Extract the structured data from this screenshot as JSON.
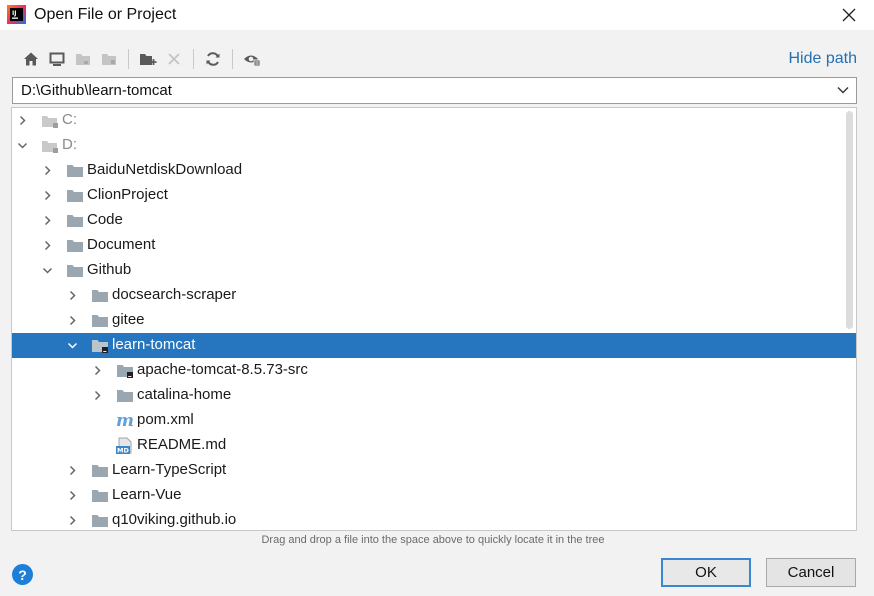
{
  "window": {
    "title": "Open File or Project",
    "close_symbol": "✕"
  },
  "toolbar": {
    "buttons": [
      {
        "name": "home-icon",
        "enabled": true
      },
      {
        "name": "desktop-icon",
        "enabled": true
      },
      {
        "name": "project-folder-icon",
        "enabled": false
      },
      {
        "name": "module-folder-icon",
        "enabled": false
      },
      {
        "name": "new-folder-icon",
        "enabled": true
      },
      {
        "name": "delete-icon",
        "enabled": false
      },
      {
        "name": "refresh-icon",
        "enabled": true
      },
      {
        "name": "show-hidden-icon",
        "enabled": true
      }
    ],
    "hide_path_label": "Hide path"
  },
  "path": {
    "value": "D:\\Github\\learn-tomcat"
  },
  "tree": {
    "rows": [
      {
        "label": "C:",
        "kind": "drive",
        "arrow": "collapsed"
      },
      {
        "label": "D:",
        "kind": "drive",
        "arrow": "expanded"
      },
      {
        "label": "BaiduNetdiskDownload",
        "kind": "folder",
        "arrow": "collapsed"
      },
      {
        "label": "ClionProject",
        "kind": "folder",
        "arrow": "collapsed"
      },
      {
        "label": "Code",
        "kind": "folder",
        "arrow": "collapsed"
      },
      {
        "label": "Document",
        "kind": "folder",
        "arrow": "collapsed"
      },
      {
        "label": "Github",
        "kind": "folder",
        "arrow": "expanded"
      },
      {
        "label": "docsearch-scraper",
        "kind": "folder",
        "arrow": "collapsed"
      },
      {
        "label": "gitee",
        "kind": "folder",
        "arrow": "collapsed"
      },
      {
        "label": "learn-tomcat",
        "kind": "project-folder",
        "arrow": "expanded",
        "selected": true
      },
      {
        "label": "apache-tomcat-8.5.73-src",
        "kind": "project-folder",
        "arrow": "collapsed"
      },
      {
        "label": "catalina-home",
        "kind": "folder",
        "arrow": "collapsed"
      },
      {
        "label": "pom.xml",
        "kind": "maven-file",
        "arrow": "none"
      },
      {
        "label": "README.md",
        "kind": "markdown-file",
        "arrow": "none"
      },
      {
        "label": "Learn-TypeScript",
        "kind": "folder",
        "arrow": "collapsed"
      },
      {
        "label": "Learn-Vue",
        "kind": "folder",
        "arrow": "collapsed"
      },
      {
        "label": "q10viking.github.io",
        "kind": "folder",
        "arrow": "collapsed"
      }
    ]
  },
  "hint": "Drag and drop a file into the space above to quickly locate it in the tree",
  "footer": {
    "help_label": "?",
    "ok_label": "OK",
    "cancel_label": "Cancel"
  },
  "colors": {
    "selection": "#2675bf",
    "link": "#2470b3",
    "default_button_border": "#3a86d0"
  }
}
